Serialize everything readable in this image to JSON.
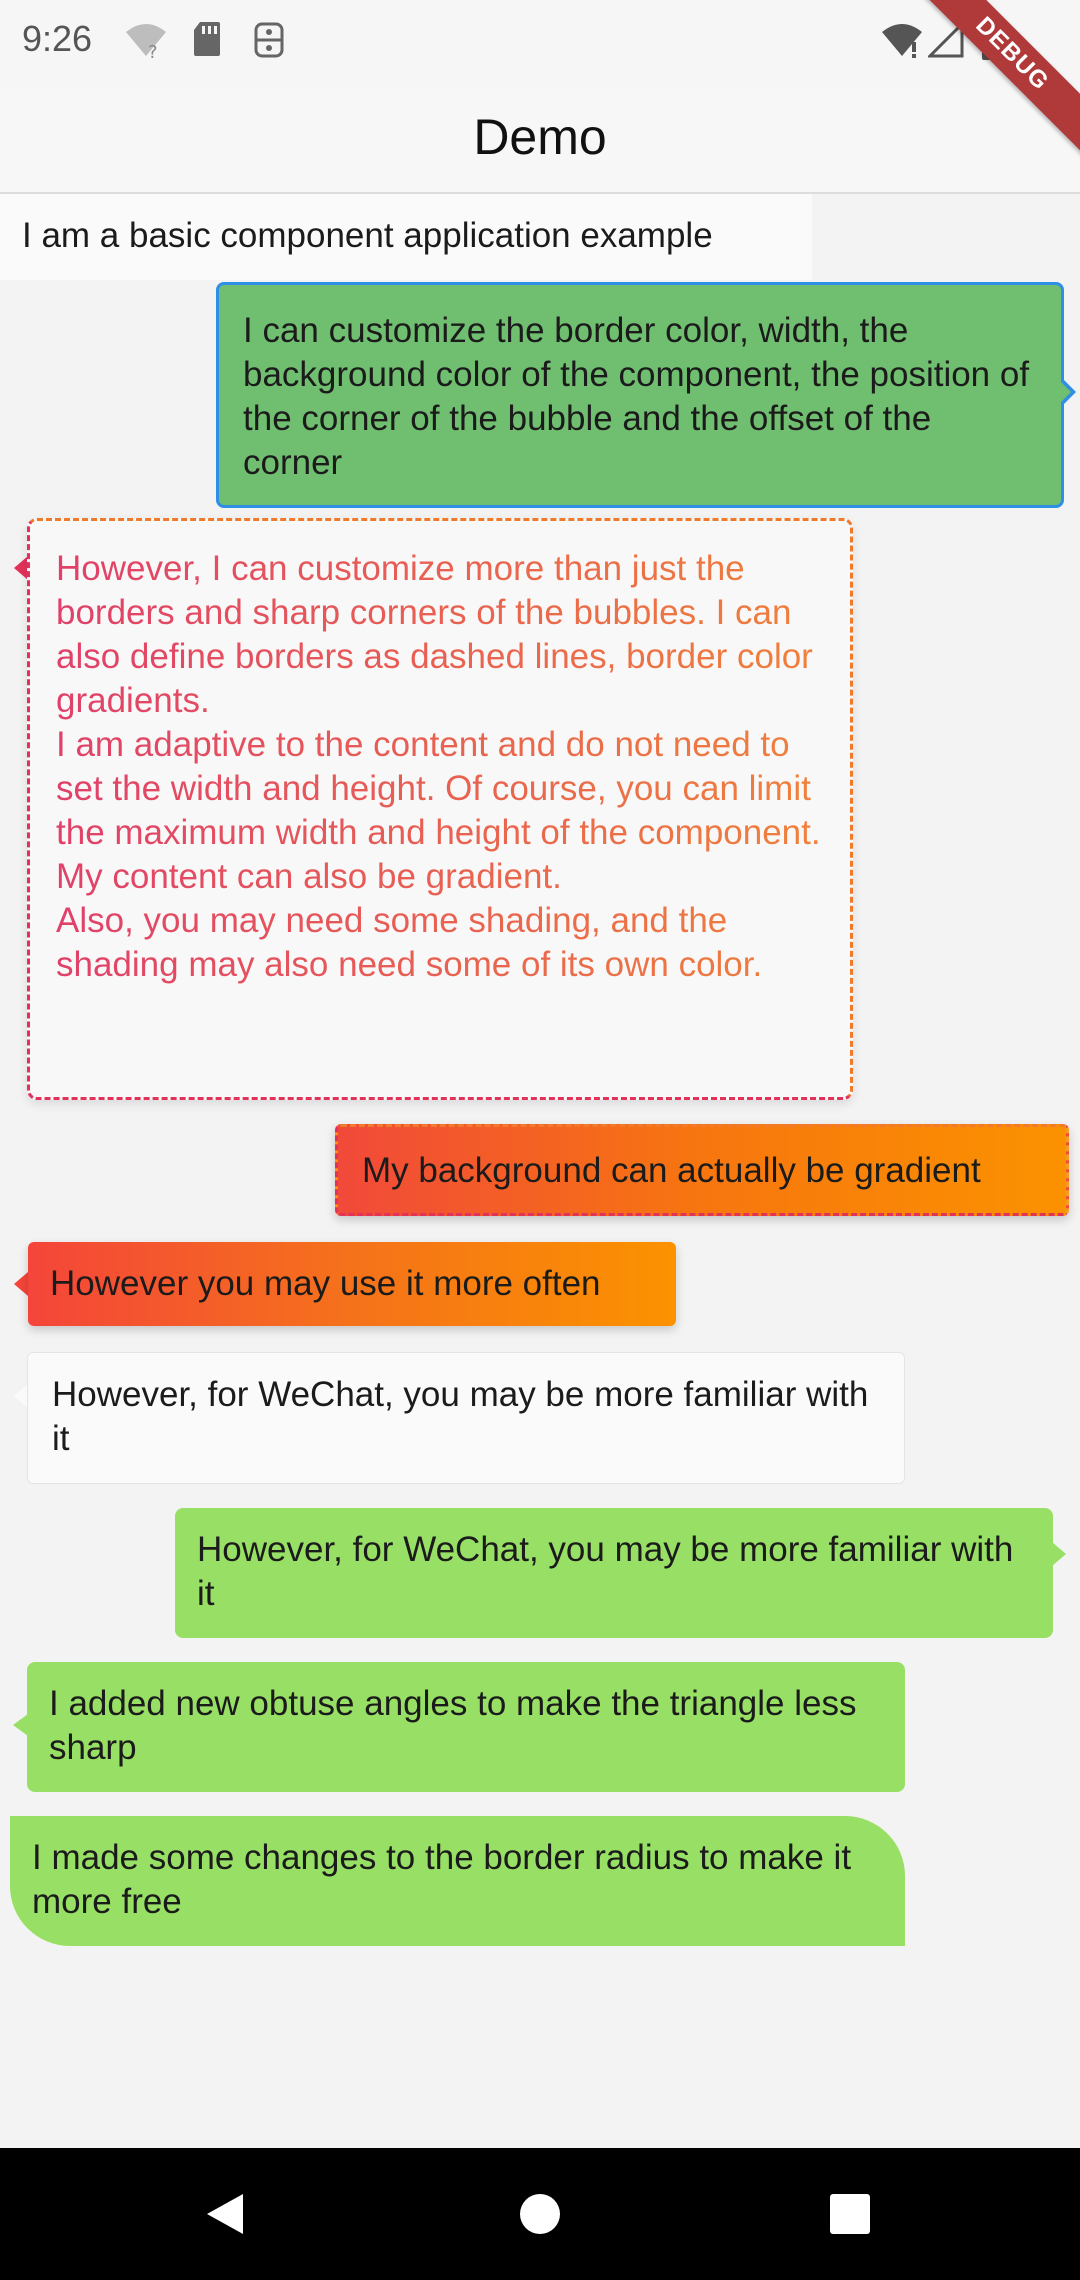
{
  "status_bar": {
    "time": "9:26",
    "icons_left": [
      "wifi-question-icon",
      "sd-card-icon",
      "sim-icon"
    ],
    "icons_right": [
      "wifi-icon",
      "cell-signal-icon",
      "battery-icon"
    ]
  },
  "debug_banner": "DEBUG",
  "app_bar": {
    "title": "Demo"
  },
  "messages": [
    {
      "text": "I am a basic component application example"
    },
    {
      "text": "I can customize the border color, width, the background color of the component, the position of the corner of the bubble and the offset of the corner"
    },
    {
      "text": "However, I can customize more than just the borders and sharp corners of the bubbles. I can also define borders as dashed lines, border color gradients.\nI am adaptive to the content and do not need to set the width and height. Of course, you can limit the maximum width and height of the component.\nMy content can also be gradient.\nAlso, you may need some shading, and the shading may also need some of its own color."
    },
    {
      "text": "My background can actually be gradient"
    },
    {
      "text": "However you may use it more often"
    },
    {
      "text": "However, for WeChat, you may be more familiar with it"
    },
    {
      "text": "However, for WeChat, you may be more familiar with it"
    },
    {
      "text": "I added new obtuse angles to make the triangle less sharp"
    },
    {
      "text": "I made some changes to the border radius to make it more free"
    }
  ],
  "colors": {
    "green_bubble": "#70bf70",
    "blue_border": "#2f8fe6",
    "wechat_green": "#98e065",
    "gradient_start": "#f1493a",
    "gradient_end": "#fb9200",
    "dashed_pink": "#e2325a",
    "dashed_orange": "#ef7a2c"
  },
  "nav_bar": {
    "buttons": [
      "back-icon",
      "home-icon",
      "recents-icon"
    ]
  }
}
